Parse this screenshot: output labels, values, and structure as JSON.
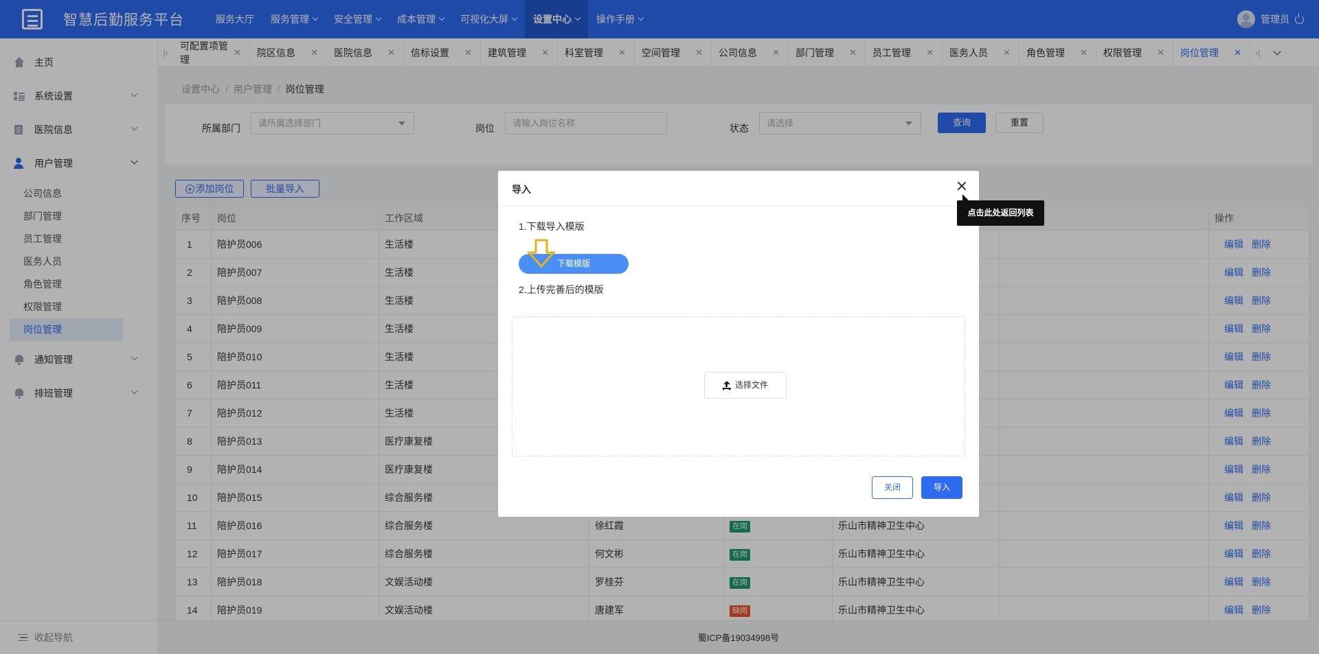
{
  "header": {
    "brand": "智慧后勤服务平台",
    "nav": [
      {
        "label": "服务大厅",
        "has_menu": false,
        "active": false
      },
      {
        "label": "服务管理",
        "has_menu": true,
        "active": false
      },
      {
        "label": "安全管理",
        "has_menu": true,
        "active": false
      },
      {
        "label": "成本管理",
        "has_menu": true,
        "active": false
      },
      {
        "label": "可视化大屏",
        "has_menu": true,
        "active": false
      },
      {
        "label": "设置中心",
        "has_menu": true,
        "active": true
      },
      {
        "label": "操作手册",
        "has_menu": true,
        "active": false
      }
    ],
    "user_name": "管理员"
  },
  "sidebar": {
    "items": [
      {
        "label": "主页",
        "icon": "home-icon"
      },
      {
        "label": "系统设置",
        "icon": "grid-icon"
      },
      {
        "label": "医院信息",
        "icon": "document-icon"
      },
      {
        "label": "用户管理",
        "icon": "user-icon"
      },
      {
        "label": "通知管理",
        "icon": "bell-icon"
      },
      {
        "label": "排班管理",
        "icon": "bell-icon"
      }
    ],
    "sub_items": [
      "公司信息",
      "部门管理",
      "员工管理",
      "医务人员",
      "角色管理",
      "权限管理",
      "岗位管理"
    ],
    "active_sub": "岗位管理",
    "collapse_label": "收起导航"
  },
  "tabs": [
    "可配置项管理",
    "院区信息",
    "医院信息",
    "信标设置",
    "建筑管理",
    "科室管理",
    "空间管理",
    "公司信息",
    "部门管理",
    "员工管理",
    "医务人员",
    "角色管理",
    "权限管理",
    "岗位管理"
  ],
  "active_tab": "岗位管理",
  "breadcrumb": [
    "设置中心",
    "用户管理",
    "岗位管理"
  ],
  "filters": {
    "dept_label": "所属部门",
    "dept_placeholder": "请所属选择部门",
    "post_label": "岗位",
    "post_placeholder": "请输入岗位名称",
    "status_label": "状态",
    "status_placeholder": "请选择",
    "query": "查询",
    "reset": "重置"
  },
  "toolbar": {
    "add": "添加岗位",
    "batch_import": "批量导入"
  },
  "table": {
    "headers": {
      "index": "序号",
      "post": "岗位",
      "area": "工作区域",
      "ops": "操作"
    },
    "edit": "编辑",
    "delete": "删除",
    "rows": [
      {
        "index": "1",
        "post": "陪护员006",
        "area": "生活楼",
        "person": "",
        "status": "",
        "hospital": ""
      },
      {
        "index": "2",
        "post": "陪护员007",
        "area": "生活楼",
        "person": "",
        "status": "",
        "hospital": ""
      },
      {
        "index": "3",
        "post": "陪护员008",
        "area": "生活楼",
        "person": "",
        "status": "",
        "hospital": ""
      },
      {
        "index": "4",
        "post": "陪护员009",
        "area": "生活楼",
        "person": "",
        "status": "",
        "hospital": ""
      },
      {
        "index": "5",
        "post": "陪护员010",
        "area": "生活楼",
        "person": "",
        "status": "",
        "hospital": ""
      },
      {
        "index": "6",
        "post": "陪护员011",
        "area": "生活楼",
        "person": "",
        "status": "",
        "hospital": ""
      },
      {
        "index": "7",
        "post": "陪护员012",
        "area": "生活楼",
        "person": "",
        "status": "",
        "hospital": ""
      },
      {
        "index": "8",
        "post": "陪护员013",
        "area": "医疗康复楼",
        "person": "",
        "status": "",
        "hospital": ""
      },
      {
        "index": "9",
        "post": "陪护员014",
        "area": "医疗康复楼",
        "person": "",
        "status": "",
        "hospital": ""
      },
      {
        "index": "10",
        "post": "陪护员015",
        "area": "综合服务楼",
        "person": "",
        "status": "",
        "hospital": ""
      },
      {
        "index": "11",
        "post": "陪护员016",
        "area": "综合服务楼",
        "person": "徐红霞",
        "status": "在岗",
        "hospital": "乐山市精神卫生中心"
      },
      {
        "index": "12",
        "post": "陪护员017",
        "area": "综合服务楼",
        "person": "何文彬",
        "status": "在岗",
        "hospital": "乐山市精神卫生中心"
      },
      {
        "index": "13",
        "post": "陪护员018",
        "area": "文娱活动楼",
        "person": "罗桂芬",
        "status": "在岗",
        "hospital": "乐山市精神卫生中心"
      },
      {
        "index": "14",
        "post": "陪护员019",
        "area": "文娱活动楼",
        "person": "唐建军",
        "status": "缺岗",
        "hospital": "乐山市精神卫生中心"
      }
    ]
  },
  "footer": "蜀ICP备19034998号",
  "dialog": {
    "title": "导入",
    "step1": "1.下载导入模版",
    "download": "下载模版",
    "step2": "2.上传完善后的模版",
    "choose_file": "选择文件",
    "close": "关闭",
    "import": "导入"
  },
  "tooltip": "点击此处返回列表",
  "colors": {
    "primary": "#2f6bf0",
    "on_duty": "#1a9a6f",
    "absent": "#e8542d",
    "indicator": "#e6b316"
  }
}
